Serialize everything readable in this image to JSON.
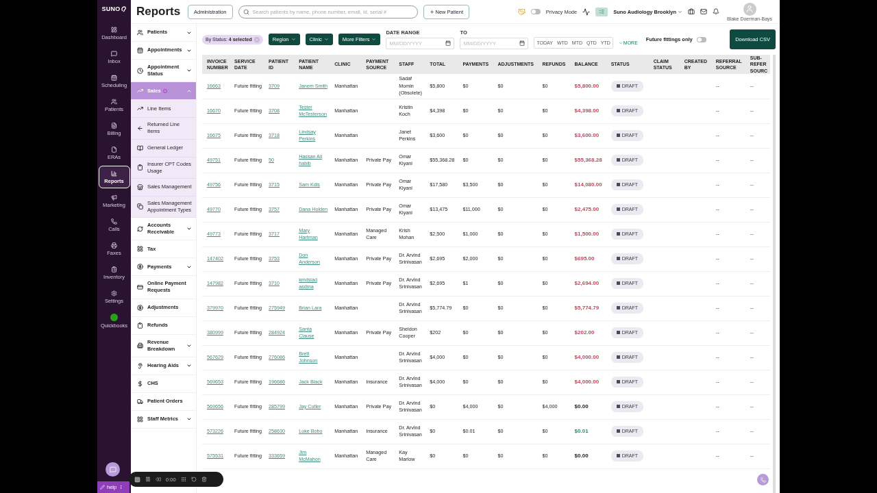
{
  "app": {
    "logo": "SUNO",
    "title": "Reports",
    "admin_button": "Administration"
  },
  "search": {
    "placeholder": "Search patients by name, phone number, email, id, serial #"
  },
  "new_patient": "New Patient",
  "privacy_mode": {
    "label": "Privacy Mode",
    "on": false
  },
  "location": "Suno Audiology Brooklyn",
  "user": "Blake Doerman-Bays",
  "rail": [
    {
      "label": "Dashboard",
      "selected": false
    },
    {
      "label": "Inbox",
      "selected": false
    },
    {
      "label": "Scheduling",
      "selected": false
    },
    {
      "label": "Patients",
      "selected": false
    },
    {
      "label": "Billing",
      "selected": false
    },
    {
      "label": "ERAs",
      "selected": false
    },
    {
      "label": "Reports",
      "selected": true
    },
    {
      "label": "Marketing",
      "selected": false
    },
    {
      "label": "Calls",
      "selected": false
    },
    {
      "label": "Faxes",
      "selected": false
    },
    {
      "label": "Inventory",
      "selected": false
    },
    {
      "label": "Settings",
      "selected": false
    },
    {
      "label": "Quickbooks",
      "selected": false
    }
  ],
  "nav": [
    {
      "label": "Patients",
      "expandable": true,
      "expanded": false,
      "selected": false
    },
    {
      "label": "Appointments",
      "expandable": true,
      "expanded": false,
      "selected": false
    },
    {
      "label": "Appointment Status",
      "expandable": true,
      "expanded": false,
      "selected": false
    },
    {
      "label": "Sales",
      "expandable": true,
      "expanded": true,
      "selected": true,
      "marked": true,
      "children": [
        {
          "label": "Line Items",
          "selected": false
        },
        {
          "label": "Returned Line Items",
          "selected": false
        },
        {
          "label": "General Ledger",
          "selected": false
        },
        {
          "label": "Insurer CPT Codes Usage",
          "selected": false
        },
        {
          "label": "Sales Management",
          "selected": false
        },
        {
          "label": "Sales Management Appointment Types",
          "selected": false
        }
      ]
    },
    {
      "label": "Accounts Receivable",
      "expandable": true,
      "expanded": false,
      "selected": false
    },
    {
      "label": "Tax",
      "expandable": false,
      "selected": false
    },
    {
      "label": "Payments",
      "expandable": true,
      "expanded": false,
      "selected": false
    },
    {
      "label": "Online Payment Requests",
      "expandable": false,
      "selected": false
    },
    {
      "label": "Adjustments",
      "expandable": false,
      "selected": false
    },
    {
      "label": "Refunds",
      "expandable": false,
      "selected": false
    },
    {
      "label": "Revenue Breakdown",
      "expandable": true,
      "expanded": false,
      "selected": false
    },
    {
      "label": "Hearing Aids",
      "expandable": true,
      "expanded": false,
      "selected": false
    },
    {
      "label": "CHS",
      "expandable": false,
      "selected": false
    },
    {
      "label": "Patient Orders",
      "expandable": false,
      "selected": false
    },
    {
      "label": "Staff Metrics",
      "expandable": true,
      "expanded": false,
      "selected": false
    }
  ],
  "filters": {
    "status_chip": "By Status: **4 selected**",
    "dropdowns": [
      "Region",
      "Clinic",
      "More Filters"
    ],
    "date_range_label": "DATE RANGE",
    "to_label": "TO",
    "from_placeholder": "MM/DD/YYYY",
    "to_placeholder": "MM/DD/YYYY",
    "quick_ranges": [
      "TODAY",
      "WTD",
      "MTD",
      "QTD",
      "YTD"
    ],
    "more": "MORE",
    "future_fittings": {
      "label": "Future fittings only",
      "on": false
    },
    "download": "Download CSV"
  },
  "table": {
    "columns": [
      "INVOICE NUMBER",
      "SERVICE DATE",
      "PATIENT ID",
      "PATIENT NAME",
      "CLINIC",
      "PAYMENT SOURCE",
      "STAFF",
      "TOTAL",
      "PAYMENTS",
      "ADJUSTMENTS",
      "REFUNDS",
      "BALANCE",
      "STATUS",
      "CLAIM STATUS",
      "CREATED BY",
      "REFERRAL SOURCE",
      "SUB- REFER SOURC"
    ],
    "rows": [
      {
        "invoice": "16663",
        "service_date": "Future fitting",
        "patient_id": "3709",
        "patient_name": "Janem Smith",
        "clinic": "Manhattan",
        "staff": "Sadaf Momin (Obsolete)",
        "total": "$5,800",
        "payments": "$0",
        "adjustments": "$0",
        "refunds": "$0",
        "balance": "$5,800.00",
        "color": "#c4465d",
        "status": "DRAFT",
        "referral_source": "--",
        "sub_referral_source": "--"
      },
      {
        "invoice": "16670",
        "service_date": "Future fitting",
        "patient_id": "3708",
        "patient_name": "Tester McTesterson",
        "clinic": "Manhattan",
        "staff": "Kristin Koch",
        "total": "$4,398",
        "payments": "$0",
        "adjustments": "$0",
        "refunds": "$0",
        "balance": "$4,398.00",
        "color": "#c4465d",
        "status": "DRAFT",
        "referral_source": "--",
        "sub_referral_source": "--"
      },
      {
        "invoice": "16675",
        "service_date": "Future fitting",
        "patient_id": "3718",
        "patient_name": "Lindsay Perkins",
        "clinic": "Manhattan",
        "staff": "Janet Perkins",
        "total": "$3,600",
        "payments": "$0",
        "adjustments": "$0",
        "refunds": "$0",
        "balance": "$3,600.00",
        "color": "#c4465d",
        "status": "DRAFT",
        "referral_source": "--",
        "sub_referral_source": "--"
      },
      {
        "invoice": "49751",
        "service_date": "Future fitting",
        "patient_id": "50",
        "patient_name": "Hassan Ali habib",
        "clinic": "Manhattan",
        "payment_source": "Private Pay",
        "staff": "Omar Kiyani",
        "total": "$55,368.28",
        "payments": "$0",
        "adjustments": "$0",
        "refunds": "$0",
        "balance": "$55,368.28",
        "color": "#c4465d",
        "status": "DRAFT",
        "referral_source": "--",
        "sub_referral_source": "--"
      },
      {
        "invoice": "49756",
        "service_date": "Future fitting",
        "patient_id": "3715",
        "patient_name": "Sam Kdls",
        "clinic": "Manhattan",
        "payment_source": "Private Pay",
        "staff": "Omar Kiyani",
        "total": "$17,580",
        "payments": "$3,500",
        "adjustments": "$0",
        "refunds": "$0",
        "balance": "$14,080.00",
        "color": "#c4465d",
        "status": "DRAFT",
        "referral_source": "--",
        "sub_referral_source": "--"
      },
      {
        "invoice": "49770",
        "service_date": "Future fitting",
        "patient_id": "3757",
        "patient_name": "Dana Holden",
        "clinic": "Manhattan",
        "payment_source": "Private Pay",
        "staff": "Omar Kiyani",
        "total": "$13,475",
        "payments": "$11,000",
        "adjustments": "$0",
        "refunds": "$0",
        "balance": "$2,475.00",
        "color": "#c4465d",
        "status": "DRAFT",
        "referral_source": "--",
        "sub_referral_source": "--"
      },
      {
        "invoice": "49773",
        "service_date": "Future fitting",
        "patient_id": "3717",
        "patient_name": "Mary Hartman",
        "clinic": "Manhattan",
        "payment_source": "Managed Care",
        "staff": "Krish Mohan",
        "total": "$2,500",
        "payments": "$1,000",
        "adjustments": "$0",
        "refunds": "$0",
        "balance": "$1,500.00",
        "color": "#c4465d",
        "status": "DRAFT",
        "referral_source": "--",
        "sub_referral_source": "--"
      },
      {
        "invoice": "147402",
        "service_date": "Future fitting",
        "patient_id": "3753",
        "patient_name": "Don Anderson",
        "clinic": "Manhattan",
        "payment_source": "Private Pay",
        "staff": "Dr. Arvind Srinivasan",
        "total": "$2,695",
        "payments": "$2,000",
        "adjustments": "$0",
        "refunds": "$0",
        "balance": "$695.00",
        "color": "#c4465d",
        "status": "DRAFT",
        "referral_source": "--",
        "sub_referral_source": "--"
      },
      {
        "invoice": "147982",
        "service_date": "Future fitting",
        "patient_id": "3710",
        "patient_name": "kmdslad asdma",
        "clinic": "Manhattan",
        "payment_source": "Private Pay",
        "staff": "Dr. Arvind Srinivasan",
        "total": "$2,695",
        "payments": "$1",
        "adjustments": "$0",
        "refunds": "$0",
        "balance": "$2,694.00",
        "color": "#c4465d",
        "status": "DRAFT",
        "referral_source": "--",
        "sub_referral_source": "--"
      },
      {
        "invoice": "379970",
        "service_date": "Future fitting",
        "patient_id": "275949",
        "patient_name": "Brian Lara",
        "clinic": "Manhattan",
        "staff": "Dr. Arvind Srinivasan",
        "total": "$5,774.79",
        "payments": "$0",
        "adjustments": "$0",
        "refunds": "$0",
        "balance": "$5,774.79",
        "color": "#c4465d",
        "status": "DRAFT",
        "referral_source": "--",
        "sub_referral_source": "--"
      },
      {
        "invoice": "380999",
        "service_date": "Future fitting",
        "patient_id": "284924",
        "patient_name": "Santa Clause",
        "clinic": "Manhattan",
        "payment_source": "Private Pay",
        "staff": "Sheldon Cooper",
        "total": "$202",
        "payments": "$0",
        "adjustments": "$0",
        "refunds": "$0",
        "balance": "$202.00",
        "color": "#c4465d",
        "status": "DRAFT",
        "referral_source": "--",
        "sub_referral_source": "--"
      },
      {
        "invoice": "567629",
        "service_date": "Future fitting",
        "patient_id": "276086",
        "patient_name": "Brett Johnson",
        "clinic": "Manhattan",
        "staff": "Dr. Arvind Srinivasan",
        "total": "$4,000",
        "payments": "$0",
        "adjustments": "$0",
        "refunds": "$0",
        "balance": "$4,000.00",
        "color": "#c4465d",
        "status": "DRAFT",
        "referral_source": "--",
        "sub_referral_source": "--"
      },
      {
        "invoice": "569653",
        "service_date": "Future fitting",
        "patient_id": "196686",
        "patient_name": "Jack Black",
        "clinic": "Manhattan",
        "payment_source": "Insurance",
        "staff": "Dr. Arvind Srinivasan",
        "total": "$4,000",
        "payments": "$0",
        "adjustments": "$0",
        "refunds": "$0",
        "balance": "$4,000.00",
        "color": "#c4465d",
        "status": "DRAFT",
        "referral_source": "--",
        "sub_referral_source": "--"
      },
      {
        "invoice": "569656",
        "service_date": "Future fitting",
        "patient_id": "285799",
        "patient_name": "Jay Cutler",
        "clinic": "Manhattan",
        "payment_source": "Private Pay",
        "staff": "Dr. Arvind Srinivasan",
        "total": "$0",
        "payments": "$4,000",
        "adjustments": "$0",
        "refunds": "$4,000",
        "balance": "$0.00",
        "color": "#222222",
        "status": "DRAFT",
        "referral_source": "--",
        "sub_referral_source": "--"
      },
      {
        "invoice": "573226",
        "service_date": "Future fitting",
        "patient_id": "258630",
        "patient_name": "Luke Bobo",
        "clinic": "Manhattan",
        "payment_source": "Insurance",
        "staff": "Dr. Arvind Srinivasan",
        "total": "$0",
        "payments": "$0.01",
        "adjustments": "$0",
        "refunds": "$0",
        "balance": "$0.01",
        "color": "#2f8a6a",
        "status": "DRAFT",
        "referral_source": "--",
        "sub_referral_source": "--"
      },
      {
        "invoice": "575531",
        "service_date": "Future fitting",
        "patient_id": "333659",
        "patient_name": "Jim McMahon",
        "clinic": "Manhattan",
        "payment_source": "Managed Care",
        "staff": "Kay Marlow",
        "total": "$0",
        "payments": "$0",
        "adjustments": "$0",
        "refunds": "$0",
        "balance": "$0.00",
        "color": "#222222",
        "status": "DRAFT",
        "referral_source": "--",
        "sub_referral_source": "--"
      }
    ]
  },
  "recorder": {
    "time": "0:00"
  },
  "help": "help"
}
